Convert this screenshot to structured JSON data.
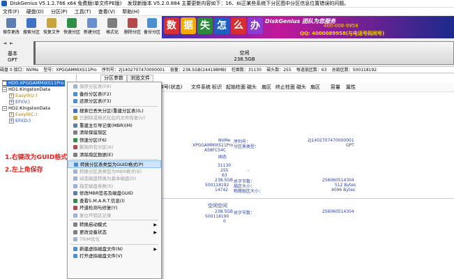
{
  "window": {
    "title": "DiskGenius V5.1.2.766 x64 免费版(单文件PE版)",
    "notice": "发现新版本 V5.2.0.884 主要更新内容如下：16、纠正某些系统下分区图中分区信息位置错误的问题。"
  },
  "menu": [
    "文件(F)",
    "硬盘(D)",
    "分区(P)",
    "工具(T)",
    "查看(V)",
    "帮助(H)"
  ],
  "toolbar": [
    {
      "label": "保存更改",
      "icon": "save-icon",
      "color": "#5a7fb0"
    },
    {
      "label": "搜索分区",
      "icon": "search-partition-icon",
      "color": "#3d72c4"
    },
    {
      "label": "恢复文件",
      "icon": "recover-file-icon",
      "color": "#c9a33c"
    },
    {
      "label": "快速分区",
      "icon": "quick-partition-icon",
      "color": "#2f8f46"
    },
    {
      "label": "新建分区",
      "icon": "new-partition-icon",
      "color": "#6a8fcf"
    },
    {
      "label": "格式化",
      "icon": "format-icon",
      "color": "#7e7e7e"
    },
    {
      "label": "删除分区",
      "icon": "delete-partition-icon",
      "color": "#b54848"
    },
    {
      "label": "备份分区",
      "icon": "backup-partition-icon",
      "color": "#4b8fd1"
    }
  ],
  "banner": {
    "tiles": [
      "数",
      "据",
      "失",
      "怎",
      "么",
      "办"
    ],
    "tile_colors": [
      "#d72f2f",
      "#f2a900",
      "#2a8a3a",
      "#1e5fc2",
      "#d72f2f",
      "#8b3bd1"
    ],
    "brand": "DiskGenius 团队为您服务",
    "phone": "400-008-9958",
    "qq": "QQ: 4000089958(与电话号码同号)"
  },
  "disk_map": {
    "nav_back": "◄",
    "nav_fwd": "►",
    "type_label": "基本",
    "type_sub": "GPT",
    "segment_name": "空闲",
    "segment_size": "238.5GB"
  },
  "disk_info": [
    "磁盘 0 接口：NVMe",
    "型号：XPGGAMMIXS11Pro",
    "序列号：2J1402707470000001",
    "容量：238.5GB(244198MB)",
    "柱面数：31130",
    "磁头数：255",
    "每道扇区数：63",
    "总扇区数：500118192"
  ],
  "tree": [
    {
      "label": "HD0:XPGGAMMIXS11Pro",
      "level": 0,
      "expander": "−",
      "selected": true
    },
    {
      "label": "HD1:KingstonData",
      "level": 0,
      "expander": "−",
      "selected": false
    },
    {
      "label": "Easy0(U:)",
      "level": 1,
      "expander": "+",
      "selected": false
    },
    {
      "label": "EFI(V:)",
      "level": 1,
      "expander": "+",
      "selected": false
    },
    {
      "label": "HD2:KingstonData",
      "level": 0,
      "expander": "−",
      "selected": false
    },
    {
      "label": "Easy0(C:)",
      "level": 1,
      "expander": "+",
      "selected": false
    },
    {
      "label": "EFI(D:)",
      "level": 1,
      "expander": "+",
      "selected": false
    }
  ],
  "tabs": [
    "分区参数",
    "浏览文件"
  ],
  "columns": [
    "序号(状态)",
    "文件系统",
    "标识",
    "起始柱面",
    "磁头",
    "扇区",
    "终止柱面",
    "磁头",
    "扇区",
    "容量",
    "属性"
  ],
  "details": {
    "interface": "NVMe",
    "model": "XPGGAMMIXS11Pro",
    "guid": "A58FC54C",
    "status": "固态",
    "serial_label": "序列号：",
    "serial_value": "2J1402707470000001",
    "ptype_label": "分区表类型：",
    "ptype_value": "GPT",
    "cylinders": "31130",
    "heads": "255",
    "sectors_per_track": "63",
    "capacity": "238.5GB",
    "total_sectors": "500118192",
    "total_bytes_label": "总字节数：",
    "total_bytes_value": "256060514304",
    "sector_size_label": "扇区大小：",
    "sector_size_value": "512 Bytes",
    "phys_sector_label": "物理扇区大小：",
    "phys_sector_value": "4096 Bytes",
    "extra_value": "14742",
    "dash": "-",
    "free_label": "空闲空间",
    "free_capacity": "238.5GB",
    "free_sectors": "500118190",
    "free_start": "0",
    "free_bytes_label": "总字节数：",
    "free_bytes_value": "256060514304"
  },
  "context_menu": [
    {
      "label": "保存分区表(F8)",
      "disabled": true,
      "icon": "#9db2d6"
    },
    {
      "label": "备份分区表(F2)",
      "disabled": false,
      "icon": "#4b8fd1"
    },
    {
      "label": "还原分区表(F3)",
      "disabled": false,
      "icon": "#4b8fd1"
    },
    {
      "sep": true
    },
    {
      "label": "搜索已丢失分区(重建分区表)(L)",
      "disabled": false,
      "icon": "#3d72c4"
    },
    {
      "label": "已删除或格式化后的文件恢复(U)",
      "disabled": true,
      "icon": "#c9a33c"
    },
    {
      "label": "重建主引导记录(MBR)(M)",
      "disabled": false,
      "icon": "#5a7fb0"
    },
    {
      "label": "清除保留扇区",
      "disabled": false,
      "icon": "#7e7e7e"
    },
    {
      "label": "快速分区(F6)",
      "disabled": false,
      "icon": "#2f8f46"
    },
    {
      "label": "删除所有分区(A)",
      "disabled": true,
      "icon": "#b54848"
    },
    {
      "label": "清除扇区数据(E)",
      "disabled": false,
      "icon": "#7e7e7e"
    },
    {
      "sep": true
    },
    {
      "label": "转换分区表类型为GUID格式(P)",
      "disabled": false,
      "icon": "#4b8fd1",
      "highlight": true
    },
    {
      "label": "转换分区表类型为MBR格式(B)",
      "disabled": true,
      "icon": "#9db2d6"
    },
    {
      "label": "动态磁盘转换为基本磁盘(D)",
      "disabled": true,
      "icon": "#9db2d6"
    },
    {
      "label": "指定磁盘参数(S)",
      "disabled": true,
      "icon": "#9db2d6"
    },
    {
      "label": "修改MBR签名及磁盘GUID",
      "disabled": false,
      "icon": "#5a7fb0"
    },
    {
      "label": "查看S.M.A.R.T.信息(I)",
      "disabled": false,
      "icon": "#2f8f46"
    },
    {
      "label": "坏道检测与修复(Y)",
      "disabled": false,
      "icon": "#b54848"
    },
    {
      "label": "复位坏扇区记录",
      "disabled": true,
      "icon": "#9db2d6"
    },
    {
      "sep": true
    },
    {
      "label": "转换启动模式",
      "disabled": false,
      "icon": "#7e7e7e",
      "arrow": "▶"
    },
    {
      "label": "更改设备状态",
      "disabled": false,
      "icon": "#7e7e7e",
      "arrow": "▶"
    },
    {
      "label": "TRIM优化",
      "disabled": true,
      "icon": "#9db2d6"
    },
    {
      "sep": true
    },
    {
      "label": "新建虚拟磁盘文件(N)",
      "disabled": false,
      "icon": "#4b8fd1",
      "arrow": "▶"
    },
    {
      "label": "打开虚拟磁盘文件(V)",
      "disabled": false,
      "icon": "#4b8fd1"
    }
  ],
  "annotations": [
    "1.右键改为GUID格式",
    "2.左上角保存"
  ]
}
